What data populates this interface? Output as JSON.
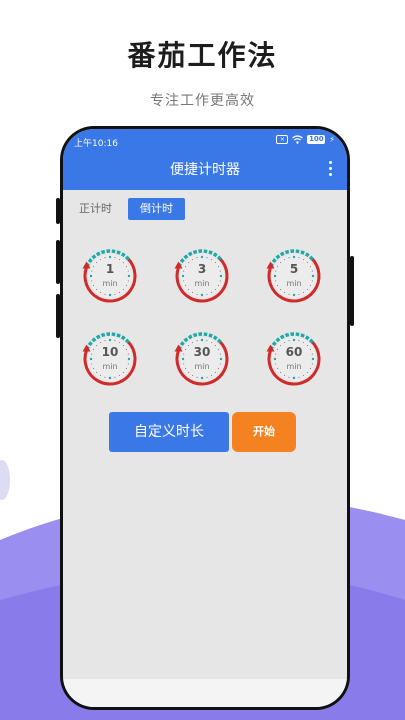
{
  "promo": {
    "title": "番茄工作法",
    "subtitle": "专注工作更高效"
  },
  "status_bar": {
    "time": "上午10:16",
    "sim_icon_label": "×",
    "battery": "100",
    "icons": [
      "sim-card-icon",
      "wifi-icon",
      "battery-icon",
      "charging-bolt-icon"
    ]
  },
  "app": {
    "title": "便捷计时器",
    "menu_icon": "more-vertical-icon"
  },
  "tabs": [
    {
      "label": "正计时",
      "active": false
    },
    {
      "label": "倒计时",
      "active": true
    }
  ],
  "timers": [
    {
      "value": "1",
      "unit": "min"
    },
    {
      "value": "3",
      "unit": "min"
    },
    {
      "value": "5",
      "unit": "min"
    },
    {
      "value": "10",
      "unit": "min"
    },
    {
      "value": "30",
      "unit": "min"
    },
    {
      "value": "60",
      "unit": "min"
    }
  ],
  "actions": {
    "custom_label": "自定义时长",
    "start_label": "开始"
  },
  "colors": {
    "primary": "#3b78e7",
    "accent_orange": "#f58220",
    "ring_red": "#d02a2a",
    "ring_teal": "#1fa8a8",
    "screen_bg": "#e6e6e6"
  }
}
